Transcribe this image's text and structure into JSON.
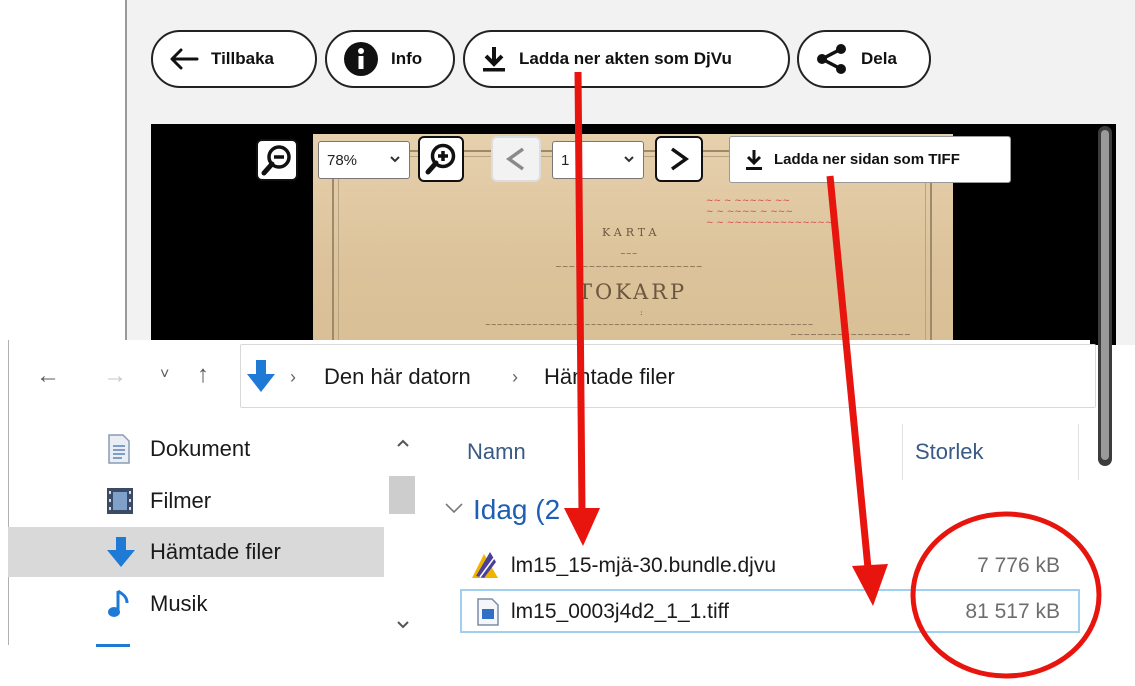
{
  "viewer": {
    "buttons": {
      "back": "Tillbaka",
      "info": "Info",
      "download_djvu": "Ladda ner akten som DjVu",
      "share": "Dela"
    },
    "zoom_level": "78%",
    "page_number": "1",
    "download_tiff": "Ladda ner sidan som TIFF",
    "map": {
      "title": "KARTA",
      "place": "TOKARP"
    }
  },
  "explorer": {
    "breadcrumb": [
      "Den här datorn",
      "Hämtade filer"
    ],
    "sidebar": [
      {
        "label": "Dokument",
        "icon": "document-icon",
        "selected": false
      },
      {
        "label": "Filmer",
        "icon": "film-icon",
        "selected": false
      },
      {
        "label": "Hämtade filer",
        "icon": "download-arrow-icon",
        "selected": true
      },
      {
        "label": "Musik",
        "icon": "music-note-icon",
        "selected": false
      }
    ],
    "columns": {
      "name": "Namn",
      "size": "Storlek"
    },
    "group": "Idag (2",
    "files": [
      {
        "name": "lm15_15-mjä-30.bundle.djvu",
        "size": "7 776 kB",
        "icon": "djvu-file-icon"
      },
      {
        "name": "lm15_0003j4d2_1_1.tiff",
        "size": "81 517 kB",
        "icon": "tiff-file-icon"
      }
    ]
  },
  "annotations": {
    "arrow_color": "#e8150f",
    "circle_color": "#e8150f"
  }
}
